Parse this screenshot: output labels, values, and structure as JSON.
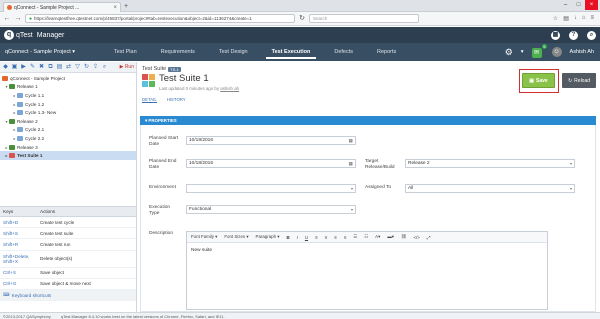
{
  "browser": {
    "tab_title": "qConnect - Sample Project ...",
    "url": "https://learnqtestfree.qtestnet.com/p/45837/portal/project#tab=testexecution&object=2&id=1136274&create=1",
    "search_placeholder": "Search"
  },
  "app": {
    "logo_text": "qTest",
    "product": "Manager",
    "help_icon": "?",
    "user_name": "Ashish Ah"
  },
  "menu": {
    "project": "qConnect - Sample Project ▾",
    "items": [
      "Test Plan",
      "Requirements",
      "Test Design",
      "Test Execution",
      "Defects",
      "Reports"
    ],
    "notifications": "5"
  },
  "tree": {
    "run_label": "▶ Run",
    "nodes": [
      "qConnect - Sample Project",
      "Release 1",
      "Cycle 1.1",
      "Cycle 1.2",
      "Cycle 1.3- New",
      "Release 2",
      "Cycle 2.1",
      "Cycle 2.2",
      "Release 3",
      "Test Suite 1"
    ]
  },
  "shortcuts": {
    "head_keys": "Keys",
    "head_actions": "Actions",
    "rows": [
      {
        "key": "Shift+D",
        "action": "Create test cycle"
      },
      {
        "key": "Shift+S",
        "action": "Create test suite"
      },
      {
        "key": "Shift+R",
        "action": "Create test run"
      },
      {
        "key": "Shift+Delete, Shift+X",
        "action": "Delete object(s)"
      },
      {
        "key": "Ctrl+S",
        "action": "Save object"
      },
      {
        "key": "Ctrl+G",
        "action": "Save object & move next"
      }
    ],
    "link": "Keyboard shortcuts"
  },
  "suite": {
    "crumb": "Test Suite",
    "crumb_badge": "TS-1",
    "title": "Test Suite 1",
    "meta_prefix": "Last updated 0 minutes ago by",
    "meta_user": "ashish ah",
    "save_label": "Save",
    "reload_label": "Reload",
    "tab_detail": "DETAIL",
    "tab_history": "HISTORY"
  },
  "properties": {
    "header": "▾ PROPERTIES",
    "planned_start_label": "Planned Start Date",
    "planned_start": "10/18/2016",
    "planned_end_label": "Planned End Date",
    "planned_end": "10/18/2016",
    "target_release_label": "Target Release/Build",
    "target_release": "Release 2",
    "environment_label": "Environment",
    "environment": "",
    "assigned_to_label": "Assigned To",
    "assigned_to": "All",
    "execution_type_label": "Execution Type",
    "execution_type": "Functional",
    "description_label": "Description",
    "description": "New suite"
  },
  "editor": {
    "font_family": "Font Family ▾",
    "font_sizes": "Font Sizes ▾",
    "paragraph": "Paragraph ▾"
  },
  "status": {
    "copyright": "©2013-2017 QASymphony",
    "notice": "qTest Manager 8.4.10 works best on the latest versions of Chrome, Firefox, Safari, and IE11."
  }
}
